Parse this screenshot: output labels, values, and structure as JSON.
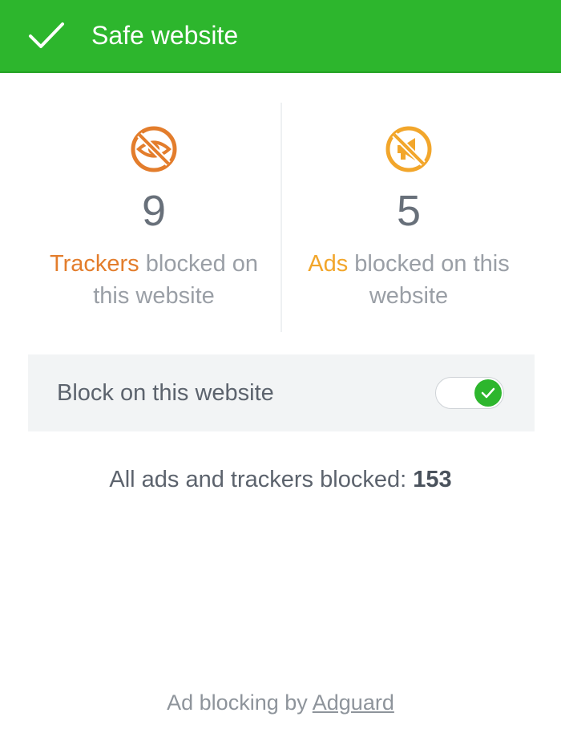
{
  "header": {
    "status_icon": "check-icon",
    "title": "Safe website",
    "color": "#2db62d"
  },
  "stats": {
    "trackers": {
      "icon": "crossed-eye-icon",
      "count": "9",
      "accent_label": "Trackers",
      "label_rest": " blocked on this website",
      "accent_color": "#e37d2c"
    },
    "ads": {
      "icon": "crossed-megaphone-icon",
      "count": "5",
      "accent_label": "Ads",
      "label_rest": " blocked on this website",
      "accent_color": "#f2a62b"
    }
  },
  "toggle": {
    "label": "Block on this website",
    "enabled": true
  },
  "summary": {
    "label": "All ads and trackers blocked: ",
    "value": "153"
  },
  "footer": {
    "prefix": "Ad blocking by ",
    "link_text": "Adguard"
  }
}
